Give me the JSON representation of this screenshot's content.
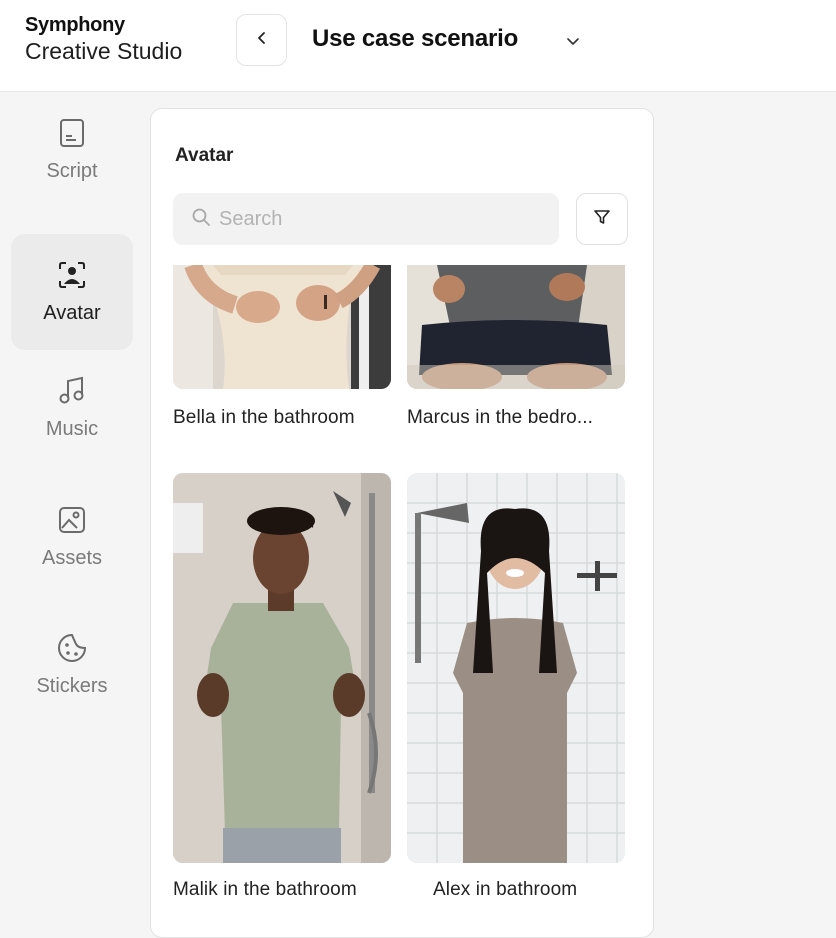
{
  "brand": {
    "line1": "Symphony",
    "line2": "Creative Studio"
  },
  "header": {
    "title": "Use case scenario",
    "back_icon": "chevron-left-icon",
    "dropdown_icon": "chevron-down-icon"
  },
  "sidebar": {
    "items": [
      {
        "label": "Script",
        "icon": "document-icon",
        "active": false
      },
      {
        "label": "Avatar",
        "icon": "avatar-icon",
        "active": true
      },
      {
        "label": "Music",
        "icon": "music-note-icon",
        "active": false
      },
      {
        "label": "Assets",
        "icon": "image-icon",
        "active": false
      },
      {
        "label": "Stickers",
        "icon": "sticker-icon",
        "active": false
      }
    ]
  },
  "panel": {
    "title": "Avatar",
    "search": {
      "placeholder": "Search",
      "value": ""
    },
    "filter_icon": "filter-icon",
    "avatars": [
      {
        "name": "Bella in the bathroom"
      },
      {
        "name": "Marcus in the bedro..."
      },
      {
        "name": "Malik in the bathroom"
      },
      {
        "name": "Alex in bathroom"
      }
    ]
  },
  "colors": {
    "active_nav": "#ebebeb",
    "panel_bg": "#ffffff",
    "page_bg": "#f5f5f5",
    "search_bg": "#f2f2f2"
  }
}
